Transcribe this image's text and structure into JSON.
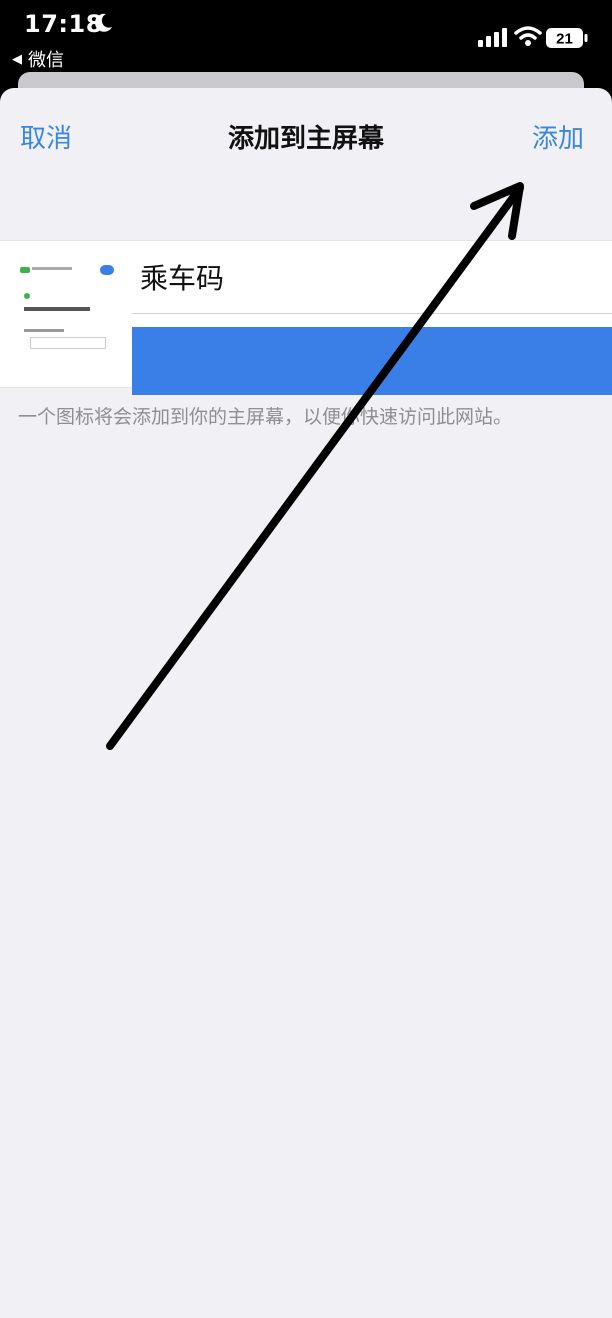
{
  "status_bar": {
    "time": "17:18",
    "back_app": "微信",
    "battery_level": "21",
    "icons": [
      "moon-icon",
      "signal-icon",
      "wifi-icon",
      "battery-icon"
    ]
  },
  "nav": {
    "cancel_label": "取消",
    "title": "添加到主屏幕",
    "add_label": "添加"
  },
  "form": {
    "name_value": "乘车码",
    "hint": "一个图标将会添加到你的主屏幕，以便你快速访问此网站。"
  },
  "colors": {
    "accent": "#3a86e0",
    "url_bar": "#3a7ee8",
    "background": "#f0f0f5"
  }
}
